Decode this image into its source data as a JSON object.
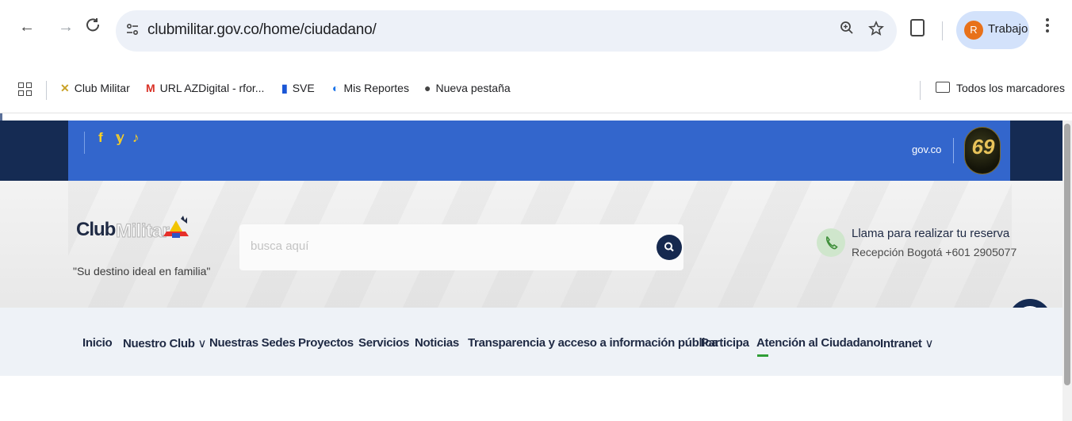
{
  "browser": {
    "url": "clubmilitar.gov.co/home/ciudadano/",
    "profile": {
      "initial": "R",
      "name": "Trabajo"
    },
    "nav": {
      "back": "←",
      "forward": "→",
      "reload": "C"
    },
    "icons": {
      "zoom": "zoom-icon",
      "star": "star-icon",
      "extensions": "puzzle-icon",
      "menu": "kebab-icon"
    }
  },
  "bookmarks": {
    "items": [
      {
        "label": "Club Militar",
        "icon": "club-militar-icon"
      },
      {
        "label": "URL AZDigital - rfor...",
        "icon": "gmail-icon"
      },
      {
        "label": "SVE",
        "icon": "bookmark-blue-icon"
      },
      {
        "label": "Mis Reportes",
        "icon": "reports-icon"
      },
      {
        "label": "Nueva pestaña",
        "icon": "chrome-icon"
      }
    ],
    "all": "Todos los marcadores"
  },
  "govbar": {
    "social": [
      "f",
      "𝕪",
      "♪"
    ],
    "govco": "gov.co",
    "badge": "69"
  },
  "header": {
    "logo_club": "Club",
    "logo_militar": "Militar",
    "tagline": "\"Su destino ideal en familia\"",
    "search_placeholder": "busca aquí",
    "call_title": "Llama para realizar tu reserva",
    "call_phone": "Recepción Bogotá +601 2905077"
  },
  "menu": {
    "items": [
      "Inicio",
      "Nuestro Club",
      "Nuestras Sedes",
      "Proyectos",
      "Servicios",
      "Noticias",
      "Transparencia y acceso a información pública",
      "Participa",
      "Atención al Ciudadano",
      "Intranet"
    ],
    "chevron": "∨",
    "active": "Atención al Ciudadano"
  },
  "colors": {
    "gov_blue": "#3366cc",
    "navy": "#152b53",
    "active_green": "#2f9e36"
  }
}
